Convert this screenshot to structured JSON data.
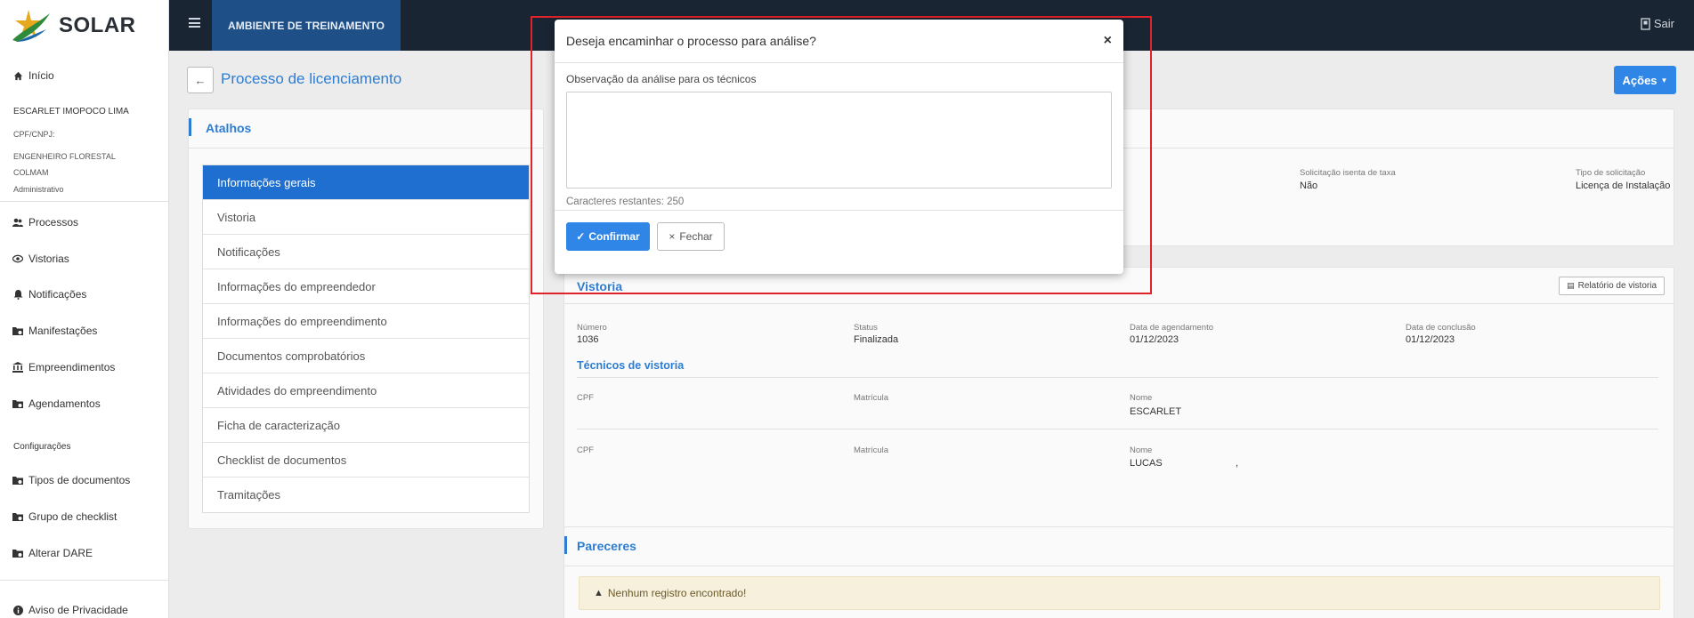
{
  "app": {
    "name": "SOLAR",
    "environment": "AMBIENTE DE TREINAMENTO",
    "logout": "Sair"
  },
  "sidebar": {
    "home": "Início",
    "user": {
      "name": "ESCARLET IMOPOCO LIMA",
      "doc_label": "CPF/CNPJ:",
      "role": "ENGENHEIRO FLORESTAL",
      "org": "COLMAM",
      "profile": "Administrativo"
    },
    "items": [
      "Processos",
      "Vistorias",
      "Notificações",
      "Manifestações",
      "Empreendimentos",
      "Agendamentos"
    ],
    "config_title": "Configurações",
    "config_items": [
      "Tipos de documentos",
      "Grupo de checklist",
      "Alterar DARE"
    ],
    "privacy": "Aviso de Privacidade"
  },
  "page": {
    "title": "Processo de licenciamento",
    "actions": "Ações"
  },
  "atalhos": {
    "title": "Atalhos",
    "items": [
      "Informações gerais",
      "Vistoria",
      "Notificações",
      "Informações do empreendedor",
      "Informações do empreendimento",
      "Documentos comprobatórios",
      "Atividades do empreendimento",
      "Ficha de caracterização",
      "Checklist de documentos",
      "Tramitações"
    ]
  },
  "info_geral": {
    "isenta_label": "Solicitação isenta de taxa",
    "isenta_value": "Não",
    "tipo_label": "Tipo de solicitação",
    "tipo_value": "Licença de Instalação"
  },
  "vistoria": {
    "title": "Vistoria",
    "report_button": "Relatório de vistoria",
    "numero_label": "Número",
    "numero": "1036",
    "status_label": "Status",
    "status": "Finalizada",
    "agendamento_label": "Data de agendamento",
    "agendamento": "01/12/2023",
    "conclusao_label": "Data de conclusão",
    "conclusao": "01/12/2023",
    "tecnicos_title": "Técnicos de vistoria",
    "tecnicos": [
      {
        "cpf_label": "CPF",
        "matricula_label": "Matrícula",
        "nome_label": "Nome",
        "nome": "ESCARLET"
      },
      {
        "cpf_label": "CPF",
        "matricula_label": "Matrícula",
        "nome_label": "Nome",
        "nome": "LUCAS",
        "extra": ","
      }
    ]
  },
  "pareceres": {
    "title": "Pareceres",
    "empty": "Nenhum registro encontrado!"
  },
  "modal": {
    "title": "Deseja encaminhar o processo para análise?",
    "close_symbol": "×",
    "field_label": "Observação da análise para os técnicos",
    "textarea_value": "",
    "chars_remaining": "Caracteres restantes: 250",
    "confirm": "Confirmar",
    "dismiss": "Fechar"
  },
  "colors": {
    "primary": "#2f86e6",
    "topbar": "#1a2533",
    "env": "#1e4f86",
    "highlight": "#e0222a",
    "active": "#1e6fd0"
  }
}
